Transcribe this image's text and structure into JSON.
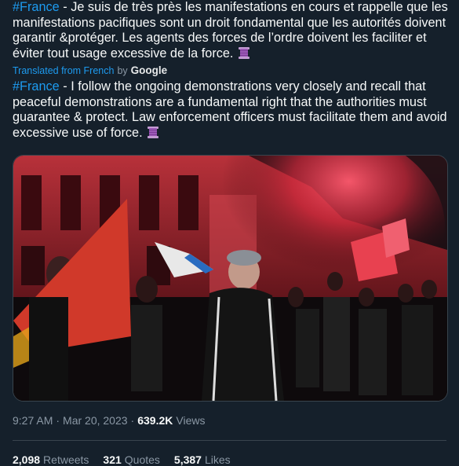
{
  "tweet": {
    "original": {
      "hashtag": "#France",
      "text": " - Je suis de très près les manifestations en cours et rappelle que les manifestations pacifiques sont un droit fondamental que les autorités doivent garantir &protéger. Les agents des forces de l’ordre doivent les faciliter et éviter tout usage excessive de la force. "
    },
    "translation_note": {
      "label": "Translated from French",
      "by": "by",
      "provider": "Google"
    },
    "translated": {
      "hashtag": "#France",
      "text": " - I follow the ongoing demonstrations very closely and recall that peaceful demonstrations are a fundamental right that the authorities must guarantee & protect. Law enforcement officers must facilitate them and avoid excessive use of force. "
    },
    "emoji_icon": "thread-spool-icon",
    "media_icon": "protest-photo",
    "meta": {
      "time": "9:27 AM",
      "sep1": "·",
      "date": "Mar 20, 2023",
      "sep2": "·",
      "views_count": "639.2K",
      "views_label": "Views"
    },
    "stats": {
      "retweets_count": "2,098",
      "retweets_label": "Retweets",
      "quotes_count": "321",
      "quotes_label": "Quotes",
      "likes_count": "5,387",
      "likes_label": "Likes"
    },
    "colors": {
      "accent": "#1d9bf0",
      "background": "#15202b",
      "muted": "#8b98a5"
    }
  }
}
